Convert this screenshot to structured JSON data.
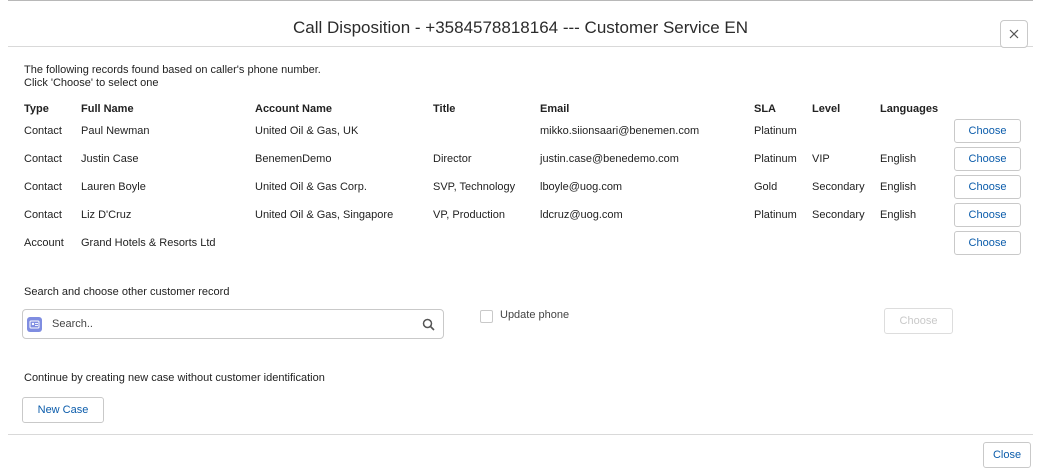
{
  "dialog": {
    "title": "Call Disposition - +3584578818164 --- Customer Service EN"
  },
  "intro": {
    "line1": "The following records found based on caller's phone number.",
    "line2": "Click 'Choose' to select one"
  },
  "records": {
    "headers": {
      "type": "Type",
      "full_name": "Full Name",
      "account_name": "Account Name",
      "title": "Title",
      "email": "Email",
      "sla": "SLA",
      "level": "Level",
      "languages": "Languages"
    },
    "choose_label": "Choose",
    "rows": [
      {
        "type": "Contact",
        "full_name": "Paul Newman",
        "account_name": "United Oil & Gas, UK",
        "title": "",
        "email": "mikko.siionsaari@benemen.com",
        "sla": "Platinum",
        "level": "",
        "languages": ""
      },
      {
        "type": "Contact",
        "full_name": "Justin Case",
        "account_name": "BenemenDemo",
        "title": "Director",
        "email": "justin.case@benedemo.com",
        "sla": "Platinum",
        "level": "VIP",
        "languages": "English"
      },
      {
        "type": "Contact",
        "full_name": "Lauren Boyle",
        "account_name": "United Oil & Gas Corp.",
        "title": "SVP, Technology",
        "email": "lboyle@uog.com",
        "sla": "Gold",
        "level": "Secondary",
        "languages": "English"
      },
      {
        "type": "Contact",
        "full_name": "Liz D'Cruz",
        "account_name": "United Oil & Gas, Singapore",
        "title": "VP, Production",
        "email": "ldcruz@uog.com",
        "sla": "Platinum",
        "level": "Secondary",
        "languages": "English"
      },
      {
        "type": "Account",
        "full_name": "Grand Hotels & Resorts Ltd",
        "account_name": "",
        "title": "",
        "email": "",
        "sla": "",
        "level": "",
        "languages": ""
      }
    ]
  },
  "search_section": {
    "label": "Search and choose other customer record",
    "placeholder": "Search..",
    "update_phone_label": "Update phone",
    "update_phone_checked": false,
    "choose_label": "Choose"
  },
  "new_case_section": {
    "label": "Continue by creating new case without customer identification",
    "button_label": "New Case"
  },
  "footer": {
    "close_label": "Close"
  },
  "colors": {
    "link_blue": "#0b5cab",
    "border": "#c9c9c9",
    "search_badge": "#7f8de1"
  }
}
